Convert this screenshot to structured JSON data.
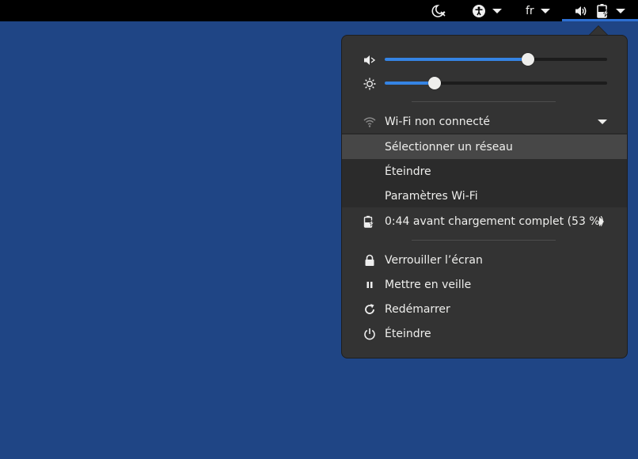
{
  "topbar": {
    "lang_label": "fr",
    "icons": [
      "night-light-off-icon",
      "accessibility-icon",
      "keyboard-layout",
      "volume-icon",
      "battery-charging-icon"
    ]
  },
  "menu": {
    "volume": {
      "icon": "audio-volume-icon",
      "level": 0.645
    },
    "brightness": {
      "icon": "brightness-icon",
      "level": 0.225
    },
    "wifi": {
      "label": "Wi-Fi non connecté",
      "items": [
        "Sélectionner un réseau",
        "Éteindre",
        "Paramètres Wi-Fi"
      ]
    },
    "battery_label": "0:44 avant chargement complet (53 %)",
    "actions": {
      "lock": "Verrouiller l’écran",
      "suspend": "Mettre en veille",
      "restart": "Redémarrer",
      "power_off": "Éteindre"
    }
  },
  "colors": {
    "desktop": "#1f4585",
    "accent": "#3584e4",
    "menu_bg": "#333333"
  }
}
